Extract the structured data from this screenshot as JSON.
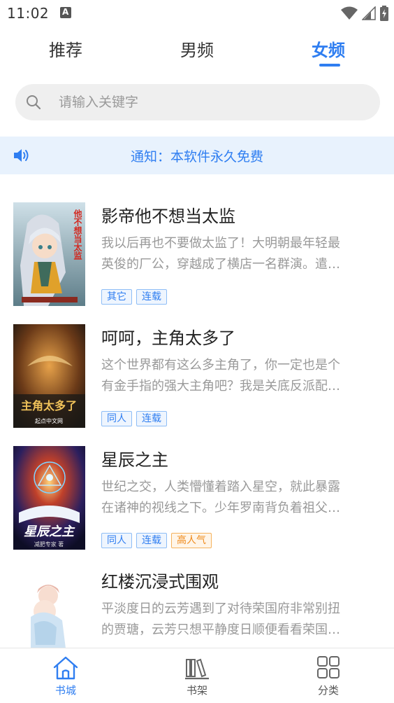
{
  "status": {
    "time": "11:02"
  },
  "tabs": [
    {
      "label": "推荐"
    },
    {
      "label": "男频"
    },
    {
      "label": "女频"
    }
  ],
  "active_tab": "女频",
  "search": {
    "placeholder": "请输入关键字"
  },
  "notice": {
    "text": "通知：本软件永久免费"
  },
  "books": [
    {
      "title": "影帝他不想当太监",
      "desc_line1": "我以后再也不要做太监了！大明朝最年轻最",
      "desc_line2": "英俊的厂公，穿越成了横店一名群演。遣…",
      "tags": [
        "其它",
        "连载"
      ],
      "cover_text": "他不想当太监"
    },
    {
      "title": "呵呵，主角太多了",
      "desc_line1": "这个世界都有这么多主角了，你一定也是个",
      "desc_line2": "有金手指的强大主角吧？我是关底反派配…",
      "tags": [
        "同人",
        "连载"
      ],
      "cover_text": "主角太多了",
      "cover_sub": "起点中文网"
    },
    {
      "title": "星辰之主",
      "desc_line1": "世纪之交，人类懵懂着踏入星空，就此暴露",
      "desc_line2": "在诸神的视线之下。少年罗南背负着祖父…",
      "tags": [
        "同人",
        "连载",
        "高人气"
      ],
      "cover_text": "星辰之主",
      "cover_sub": "减肥专家 著"
    },
    {
      "title": "红楼沉浸式围观",
      "desc_line1": "平淡度日的云芳遇到了对待荣国府非常别扭",
      "desc_line2": "的贾瑭，云芳只想平静度日顺便看看荣国…",
      "tags": []
    }
  ],
  "bottom_nav": [
    {
      "label": "书城",
      "icon": "home-icon"
    },
    {
      "label": "书架",
      "icon": "bookshelf-icon"
    },
    {
      "label": "分类",
      "icon": "grid-icon"
    }
  ],
  "colors": {
    "accent": "#2f7ef1",
    "notice_bg": "#e8f2fd",
    "hot_tag": "#ef8a1b"
  }
}
